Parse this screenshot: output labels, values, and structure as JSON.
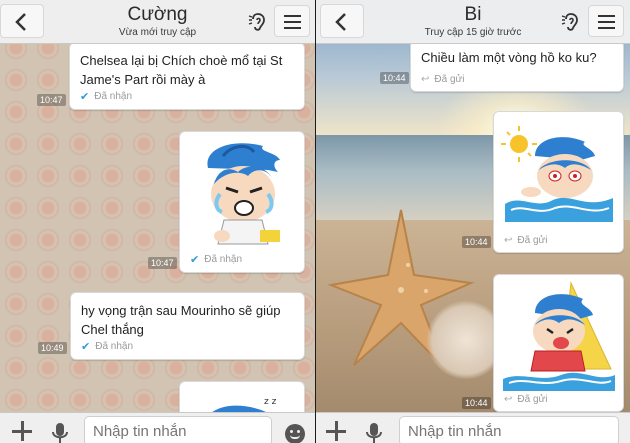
{
  "left_chat": {
    "title": "Cường",
    "subtitle": "Vừa mới truy cập",
    "messages": [
      {
        "text": "Chelsea lại bị Chích choè mổ tại St Jame's Part rồi mày à",
        "time": "10:47",
        "status": "Đã nhận"
      },
      {
        "type": "sticker",
        "time": "10:47",
        "status": "Đã nhận"
      },
      {
        "text": "hy vọng trận sau Mourinho sẽ giúp Chel thắng",
        "time": "10:49",
        "status": "Đã nhận"
      },
      {
        "type": "sticker"
      }
    ],
    "input_placeholder": "Nhập tin nhắn"
  },
  "right_chat": {
    "title": "Bi",
    "subtitle": "Truy cập 15 giờ trước",
    "messages": [
      {
        "text": "Chiều làm một vòng hồ ko ku?",
        "time": "10:44",
        "status": "Đã gửi"
      },
      {
        "type": "sticker",
        "time": "10:44",
        "status": "Đã gửi"
      },
      {
        "type": "sticker",
        "time": "10:44",
        "status": "Đã gửi"
      }
    ],
    "input_placeholder": "Nhập tin nhắn"
  },
  "colors": {
    "header_bg": "#f0f0f0",
    "check_blue": "#2e9cd8",
    "bubble_bg": "#ffffff"
  },
  "icons": [
    "back-arrow-icon",
    "ear-icon",
    "menu-icon",
    "check-icon",
    "reply-icon",
    "plus-icon",
    "mic-icon",
    "emoji-icon"
  ]
}
